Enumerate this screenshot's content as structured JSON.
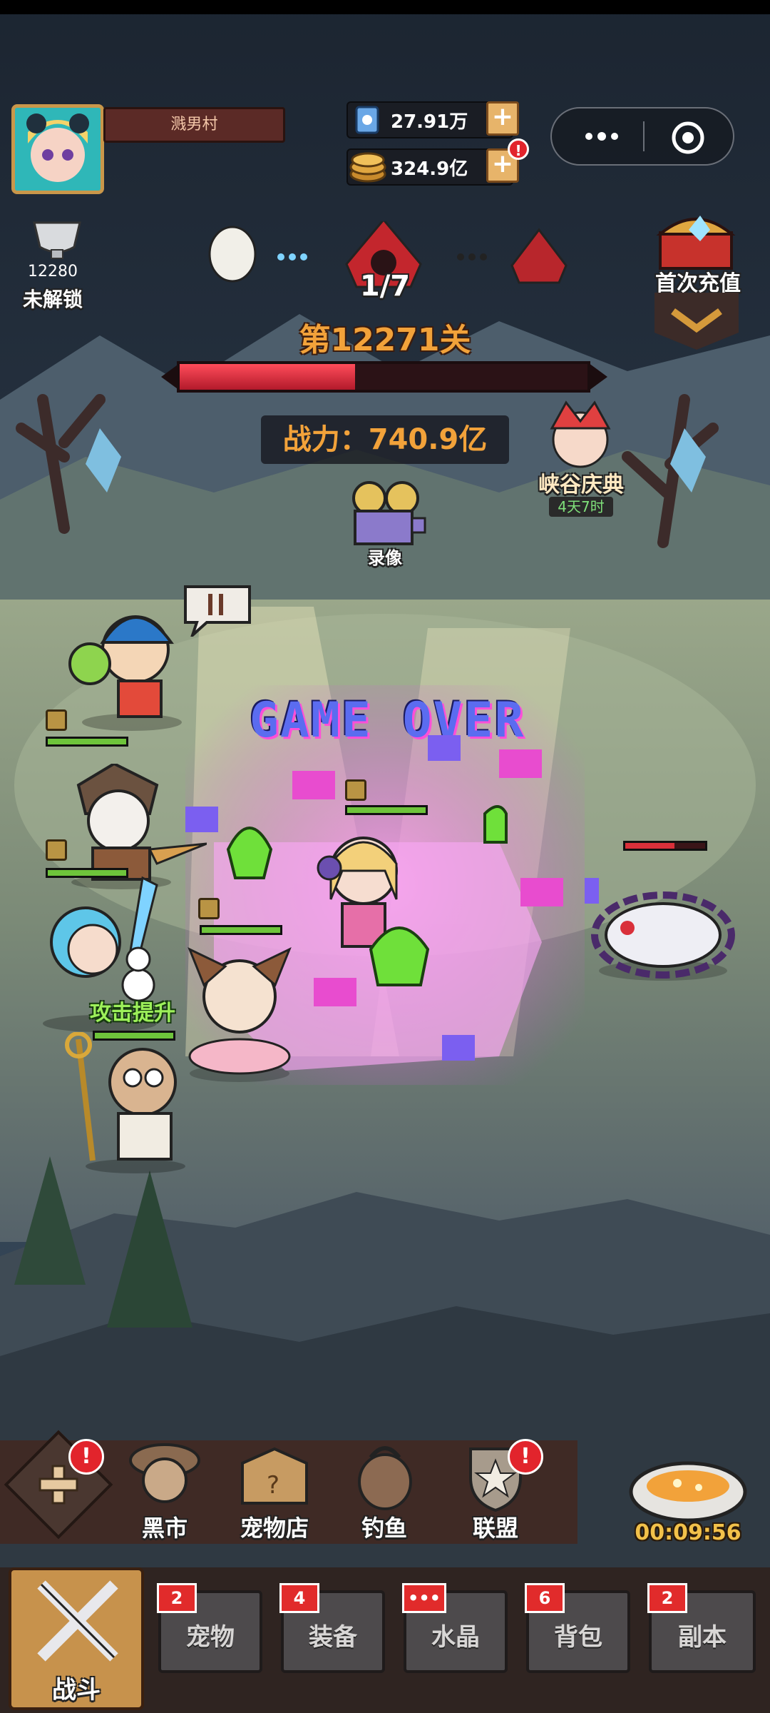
{
  "colors": {
    "accent_gold": "#f2a23a",
    "hp_red": "#e0303c",
    "hp_green": "#6ec43b",
    "badge_red": "#e12b2b"
  },
  "player": {
    "name": "溅男村"
  },
  "resources": {
    "gems": "27.91万",
    "coins": "324.9亿",
    "coins_alert": "!"
  },
  "trophy": {
    "value": "12280",
    "label": "未解锁"
  },
  "wave": {
    "progress": "1/7"
  },
  "stage": {
    "title": "第12271关",
    "progress_fraction": 0.43
  },
  "power": {
    "label": "战力：740.9亿"
  },
  "first_recharge": {
    "label": "首次充值"
  },
  "event": {
    "name": "峡谷庆典",
    "timer": "4天7时"
  },
  "record": {
    "label": "录像"
  },
  "battle": {
    "game_over_text": "GAME OVER",
    "buff_text": "攻击提升"
  },
  "menu": {
    "items": [
      {
        "label": "",
        "icon": "plus-icon",
        "alert": "!"
      },
      {
        "label": "黑市",
        "icon": "merchant-icon"
      },
      {
        "label": "宠物店",
        "icon": "box-icon"
      },
      {
        "label": "钓鱼",
        "icon": "fishing-bag-icon"
      },
      {
        "label": "联盟",
        "icon": "shield-star-icon",
        "alert": "!"
      }
    ],
    "chest_timer": "00:09:56"
  },
  "tabs": [
    {
      "label": "战斗",
      "badge": ""
    },
    {
      "label": "宠物",
      "badge": "2"
    },
    {
      "label": "装备",
      "badge": "4"
    },
    {
      "label": "水晶",
      "badge": "•••"
    },
    {
      "label": "背包",
      "badge": "6"
    },
    {
      "label": "副本",
      "badge": "2"
    }
  ]
}
